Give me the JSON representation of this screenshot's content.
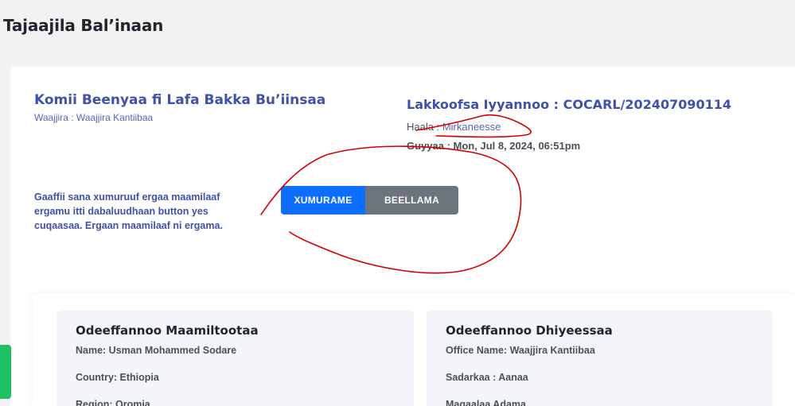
{
  "page": {
    "title": "Tajaajila Bal’inaan"
  },
  "application": {
    "service_title": "Komii Beenyaa fi Lafa Bakka Bu’iinsaa",
    "office_line": "Waajjira : Waajjira Kantiibaa",
    "tracking_line": "Lakkoofsa Iyyannoo : COCARL/202407090114",
    "status_label": "Haala : ",
    "status_value": "Mirkaneesse",
    "date_line": "Guyyaa : Mon, Jul 8, 2024, 06:51pm"
  },
  "decision": {
    "instruction": "Gaaffii sana xumuruuf ergaa maamilaaf ergamu itti dabaluudhaan button yes cuqaasaa. Ergaan maamilaaf ni ergama.",
    "accept_label": "XUMURAME",
    "reject_label": "BEELLAMA"
  },
  "customer_info": {
    "title": "Odeeffannoo Maamiltootaa",
    "rows": [
      "Name: Usman Mohammed Sodare",
      "Country: Ethiopia",
      "Region: Oromia"
    ]
  },
  "provider_info": {
    "title": "Odeeffannoo Dhiyeessaa",
    "rows": [
      "Office Name: Waajjira Kantiibaa",
      "Sadarkaa : Aanaa",
      "Magaalaa Adama"
    ]
  },
  "colors": {
    "accent_blue": "#3f51a8",
    "accept_button": "#0d6efd",
    "reject_button": "#6c757d",
    "annotation_red": "#d40000",
    "side_tab_green": "#1fbf63"
  }
}
